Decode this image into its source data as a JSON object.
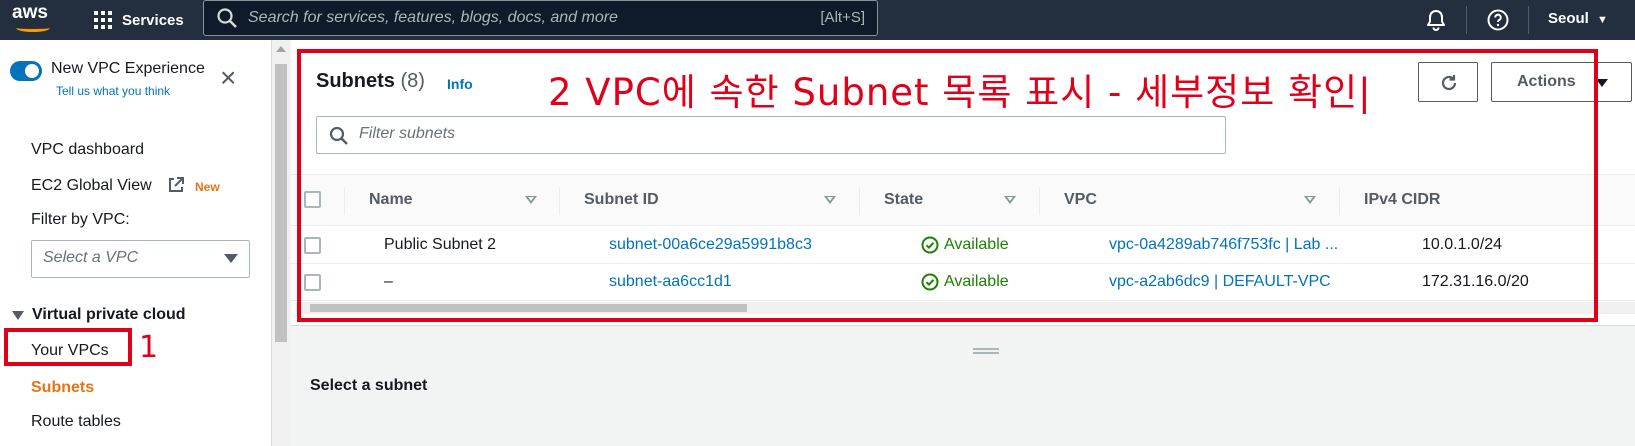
{
  "topbar": {
    "logo_text": "aws",
    "services_label": "Services",
    "search_placeholder": "Search for services, features, blogs, docs, and more",
    "search_shortcut": "[Alt+S]",
    "region_label": "Seoul"
  },
  "sidebar": {
    "new_vpc_experience_label": "New VPC Experience",
    "tell_us_label": "Tell us what you think",
    "vpc_dashboard_label": "VPC dashboard",
    "ec2_global_view_label": "EC2 Global View",
    "new_badge": "New",
    "filter_label": "Filter by VPC:",
    "select_vpc_placeholder": "Select a VPC",
    "section_title": "Virtual private cloud",
    "items": [
      {
        "label": "Your VPCs"
      },
      {
        "label": "Subnets"
      },
      {
        "label": "Route tables"
      }
    ],
    "annotation_number": "1"
  },
  "main": {
    "title": "Subnets",
    "count": "(8)",
    "info_label": "Info",
    "actions_label": "Actions",
    "filter_placeholder": "Filter subnets",
    "annotation_text": "2 VPC에 속한 Subnet 목록 표시 - 세부정보 확인|",
    "columns": [
      "Name",
      "Subnet ID",
      "State",
      "VPC",
      "IPv4 CIDR"
    ],
    "rows": [
      {
        "name": "Public Subnet 2",
        "subnet_id": "subnet-00a6ce29a5991b8c3",
        "state": "Available",
        "vpc": "vpc-0a4289ab746f753fc | Lab ...",
        "cidr": "10.0.1.0/24"
      },
      {
        "name": "–",
        "subnet_id": "subnet-aa6cc1d1",
        "state": "Available",
        "vpc": "vpc-a2ab6dc9 | DEFAULT-VPC",
        "cidr": "172.31.16.0/20"
      }
    ],
    "detail_placeholder": "Select a subnet"
  },
  "colors": {
    "topbar_bg": "#232f3e",
    "accent_orange": "#ec7211",
    "link_blue": "#0073bb",
    "success_green": "#1d8102",
    "annotation_red": "#e0001a"
  }
}
